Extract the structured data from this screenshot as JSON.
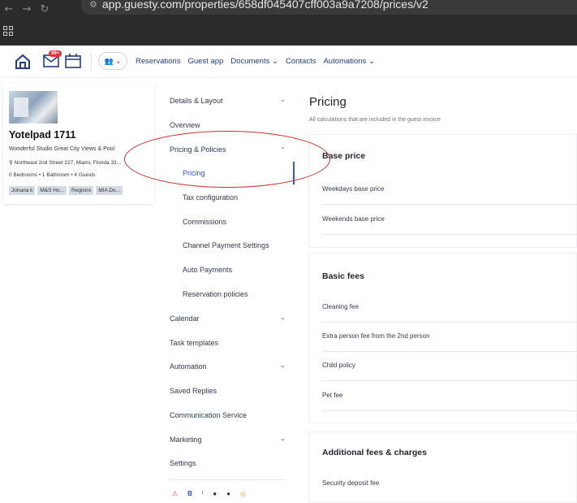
{
  "browser": {
    "url": "app.guesty.com/properties/658df045407cff003a9a7208/prices/v2",
    "back_icon": "arrow-left-icon",
    "forward_icon": "arrow-right-icon",
    "reload_icon": "reload-icon"
  },
  "header": {
    "inbox_badge": "99+",
    "nav": [
      "Reservations",
      "Guest app",
      "Documents",
      "Contacts",
      "Automations"
    ]
  },
  "property": {
    "name": "Yotelpad 1711",
    "description": "Wonderful Studio Great City Views & Pool",
    "address": "Northeast 2nd Street 227, Miami, Florida 33...",
    "meta": "0 Bedrooms • 1 Bathroom • 4 Guests",
    "tags": [
      "Johana k",
      "M&S Ho...",
      "Registro",
      "MIA Do..."
    ]
  },
  "settings_nav": {
    "items": [
      {
        "label": "Details & Layout"
      },
      {
        "label": "Overview"
      },
      {
        "label": "Pricing & Policies"
      },
      {
        "label": "Pricing"
      },
      {
        "label": "Tax configuration"
      },
      {
        "label": "Commissions"
      },
      {
        "label": "Channel Payment Settings"
      },
      {
        "label": "Auto Payments"
      },
      {
        "label": "Reservation policies"
      },
      {
        "label": "Calendar"
      },
      {
        "label": "Task templates"
      },
      {
        "label": "Automation"
      },
      {
        "label": "Saved Replies"
      },
      {
        "label": "Communication Service"
      },
      {
        "label": "Marketing"
      },
      {
        "label": "Settings"
      }
    ]
  },
  "main": {
    "title": "Pricing",
    "subtitle": "All calculations that are included in the guest invoice",
    "sections": [
      {
        "title": "Base price",
        "rows": [
          "Weekdays base price",
          "Weekends base price"
        ]
      },
      {
        "title": "Basic fees",
        "rows": [
          "Cleaning fee",
          "Extra person fee from the 2nd person",
          "Child policy",
          "Pet fee"
        ]
      },
      {
        "title": "Additional fees & charges",
        "rows": [
          "Security deposit fee"
        ]
      }
    ]
  },
  "colors": {
    "accent": "#2f56d9",
    "nav_link": "#233c84",
    "annotation": "#d42a2a",
    "badge": "#e0303a"
  }
}
